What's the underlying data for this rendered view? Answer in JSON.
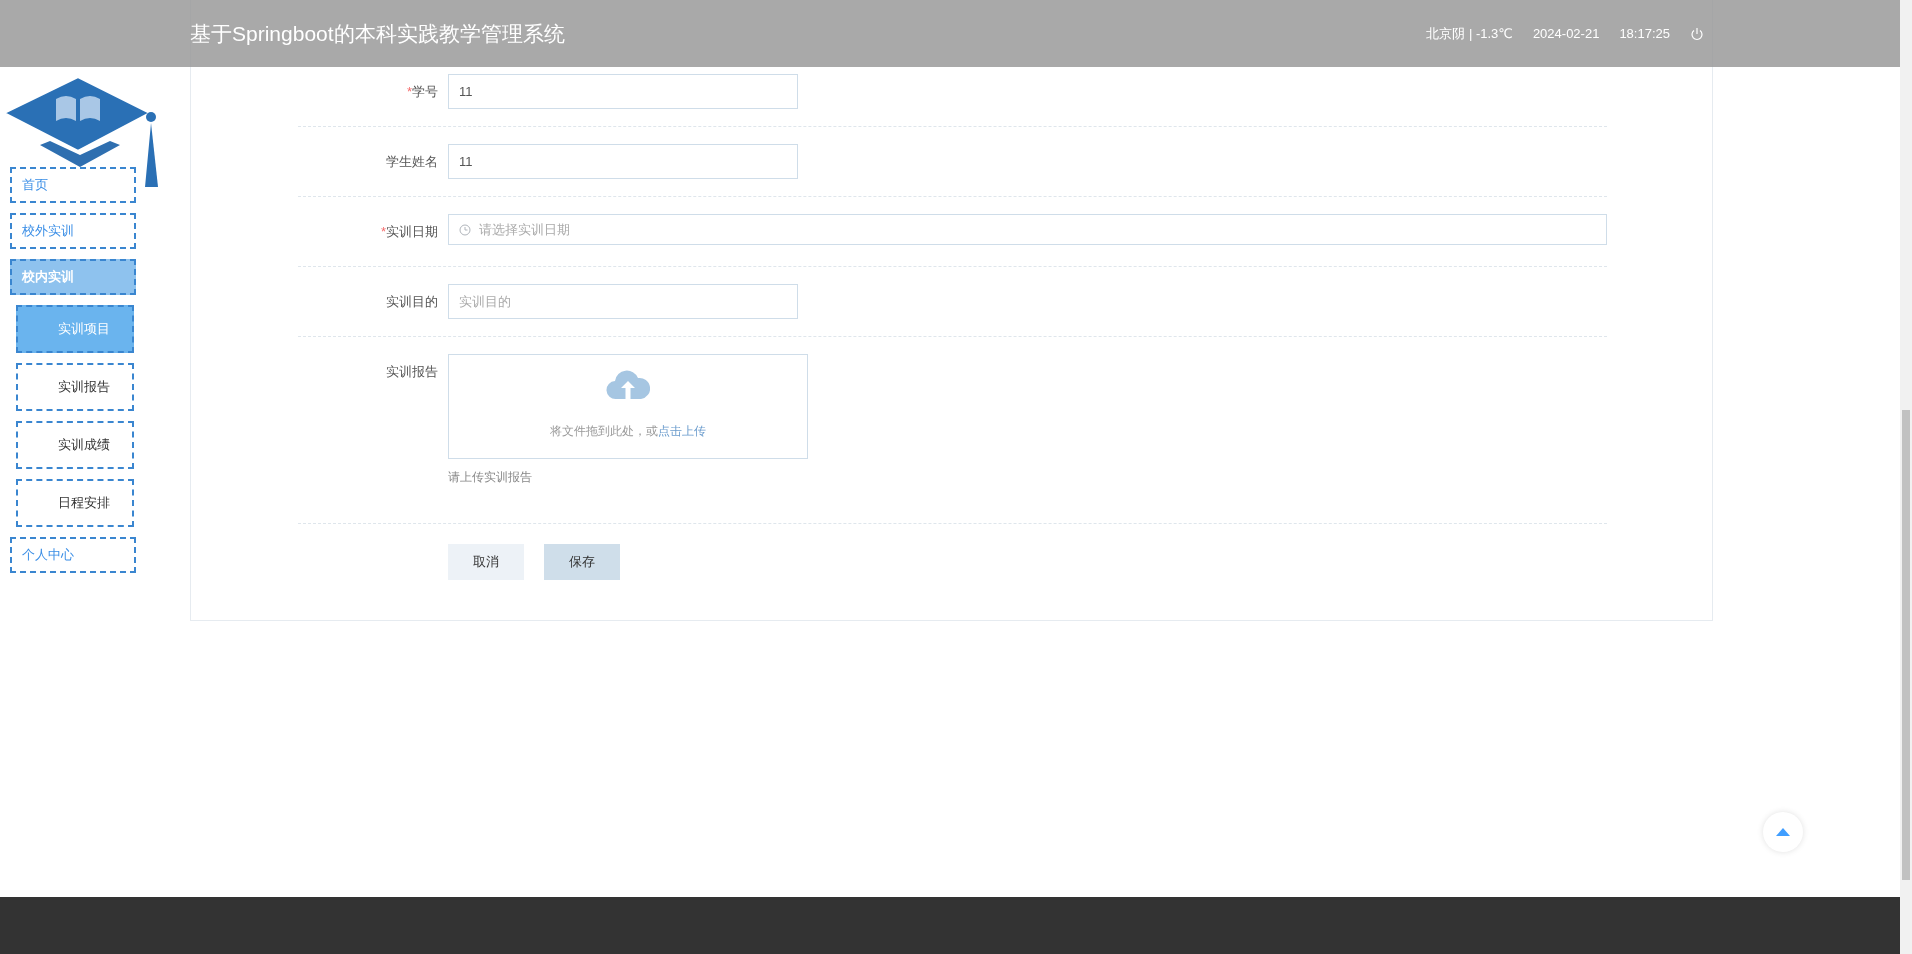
{
  "header": {
    "title": "基于Springboot的本科实践教学管理系统",
    "weather": "北京阴 | -1.3℃",
    "date": "2024-02-21",
    "time": "18:17:25"
  },
  "sidebar": {
    "menu": [
      {
        "label": "首页",
        "selected": false
      },
      {
        "label": "校外实训",
        "selected": false
      },
      {
        "label": "校内实训",
        "selected": true,
        "children": [
          {
            "label": "实训项目",
            "selected": true
          },
          {
            "label": "实训报告",
            "selected": false
          },
          {
            "label": "实训成绩",
            "selected": false
          },
          {
            "label": "日程安排",
            "selected": false
          }
        ]
      },
      {
        "label": "个人中心",
        "selected": false
      }
    ]
  },
  "form": {
    "fields": [
      {
        "kind": "text",
        "label": "学号",
        "mark": "*",
        "value": "11"
      },
      {
        "kind": "text",
        "label": "学生姓名",
        "value": "11"
      },
      {
        "kind": "date",
        "label": "实训日期",
        "mark": "*",
        "placeholder": "请选择实训日期"
      },
      {
        "kind": "text",
        "label": "实训目的",
        "placeholder": "实训目的"
      },
      {
        "kind": "upload",
        "label": "实训报告",
        "drop_text": "将文件拖到此处，或",
        "link": "点击上传",
        "hint": "请上传实训报告"
      }
    ],
    "buttons": [
      {
        "kind": "cancel",
        "label": "取消"
      },
      {
        "kind": "save",
        "label": "保存"
      }
    ]
  }
}
